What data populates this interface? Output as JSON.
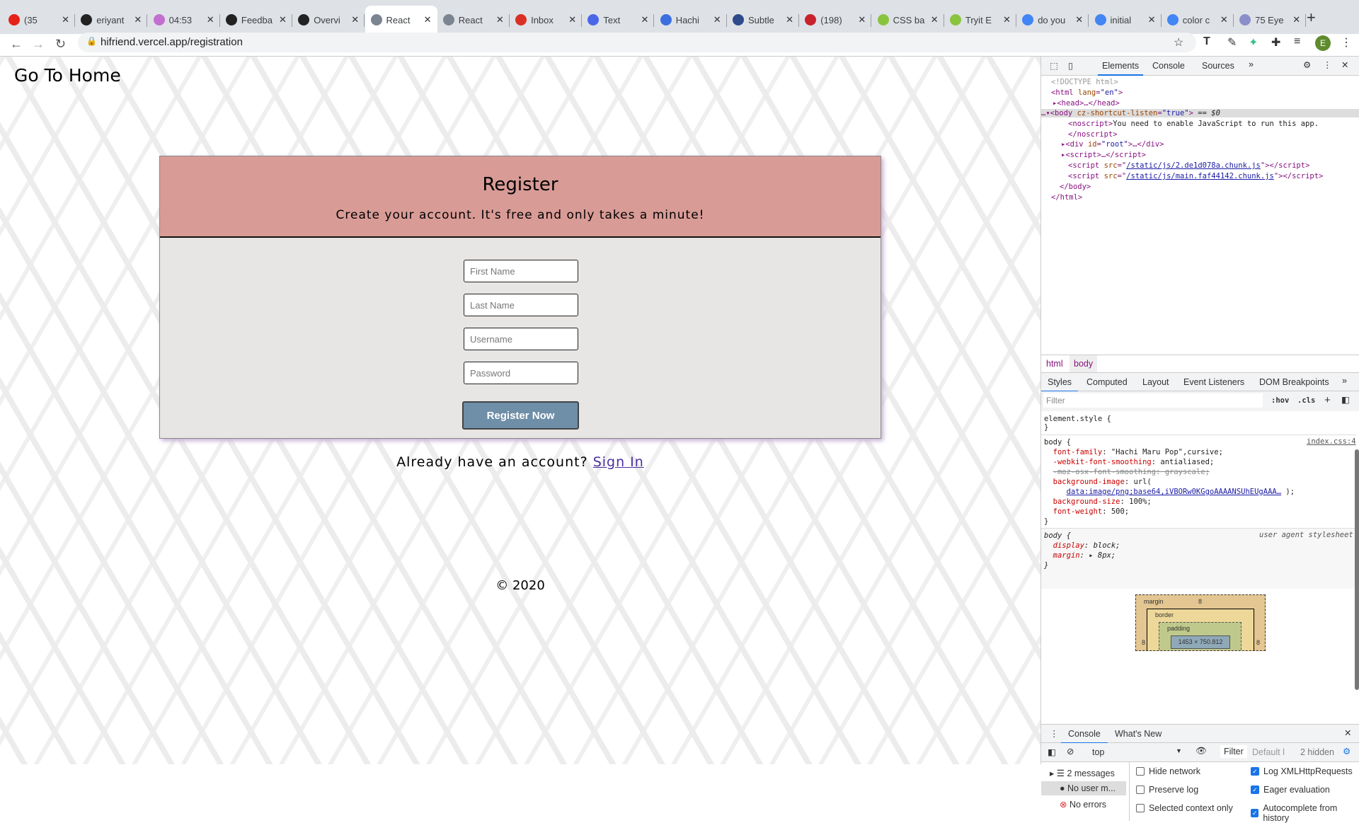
{
  "browser": {
    "tabs": [
      {
        "title": "(35",
        "icon": "youtube-icon",
        "color": "#e62117"
      },
      {
        "title": "eriyant",
        "icon": "github-icon",
        "color": "#222"
      },
      {
        "title": "04:53",
        "icon": "timer-icon",
        "color": "#c36fd1"
      },
      {
        "title": "Feedba",
        "icon": "typora-icon",
        "color": "#222"
      },
      {
        "title": "Overvi",
        "icon": "typora-icon",
        "color": "#222"
      },
      {
        "title": "React",
        "icon": "robot-icon",
        "color": "#7b8591"
      },
      {
        "title": "React",
        "icon": "robot-icon",
        "color": "#7b8591"
      },
      {
        "title": "Inbox",
        "icon": "gmail-icon",
        "color": "#d93025"
      },
      {
        "title": "Text",
        "icon": "chat-icon",
        "color": "#4a67e8"
      },
      {
        "title": "Hachi",
        "icon": "fonts-icon",
        "color": "#3b6fe0"
      },
      {
        "title": "Subtle",
        "icon": "subtle-icon",
        "color": "#2d4a8a"
      },
      {
        "title": "(198)",
        "icon": "pinterest-icon",
        "color": "#c8232c"
      },
      {
        "title": "CSS ba",
        "icon": "w3schools-icon",
        "color": "#8ac43f"
      },
      {
        "title": "Tryit E",
        "icon": "w3schools-icon",
        "color": "#8ac43f"
      },
      {
        "title": "do you",
        "icon": "google-icon",
        "color": "#4285f4"
      },
      {
        "title": "initial",
        "icon": "google-icon",
        "color": "#4285f4"
      },
      {
        "title": "color c",
        "icon": "google-icon",
        "color": "#4285f4"
      },
      {
        "title": "75 Eye",
        "icon": "dw-icon",
        "color": "#8b8fc9"
      }
    ],
    "active_tab": 5,
    "url": "hifriend.vercel.app/registration",
    "profile_initial": "E"
  },
  "page": {
    "home_link": "Go To Home",
    "card_title": "Register",
    "card_subtitle": "Create your account. It's free and only takes a minute!",
    "fields": [
      {
        "placeholder": "First Name"
      },
      {
        "placeholder": "Last Name"
      },
      {
        "placeholder": "Username"
      },
      {
        "placeholder": "Password"
      }
    ],
    "submit": "Register Now",
    "already": "Already have an account?",
    "signin": "Sign In",
    "footer": "© 2020"
  },
  "devtools": {
    "tabs": [
      "Elements",
      "Console",
      "Sources"
    ],
    "dom": {
      "doctype": "<!DOCTYPE html>",
      "noscript_text": "You need to enable JavaScript to run this app.",
      "script1": "/static/js/2.de1d078a.chunk.js",
      "script2": "/static/js/main.faf44142.chunk.js"
    },
    "crumbs": [
      "html",
      "body"
    ],
    "style_tabs": [
      "Styles",
      "Computed",
      "Layout",
      "Event Listeners",
      "DOM Breakpoints"
    ],
    "filter_placeholder": "Filter",
    "hov": ":hov",
    "cls": ".cls",
    "rule_source": "index.css:4",
    "ua_label": "user agent stylesheet",
    "box_model": {
      "margin_label": "margin",
      "border_label": "border",
      "padding_label": "padding",
      "margin": "8",
      "size": "1453 × 750.812",
      "dash": "–"
    },
    "console": {
      "tabs": [
        "Console",
        "What's New"
      ],
      "context": "top",
      "filter": "Filter",
      "levels": "Default l",
      "hidden": "2 hidden",
      "sidebar": [
        "2 messages",
        "No user m...",
        "No errors"
      ],
      "options": [
        {
          "label": "Hide network",
          "checked": false
        },
        {
          "label": "Preserve log",
          "checked": false
        },
        {
          "label": "Selected context only",
          "checked": false
        },
        {
          "label": "Log XMLHttpRequests",
          "checked": true
        },
        {
          "label": "Eager evaluation",
          "checked": true
        },
        {
          "label": "Autocomplete from history",
          "checked": true
        }
      ]
    }
  }
}
